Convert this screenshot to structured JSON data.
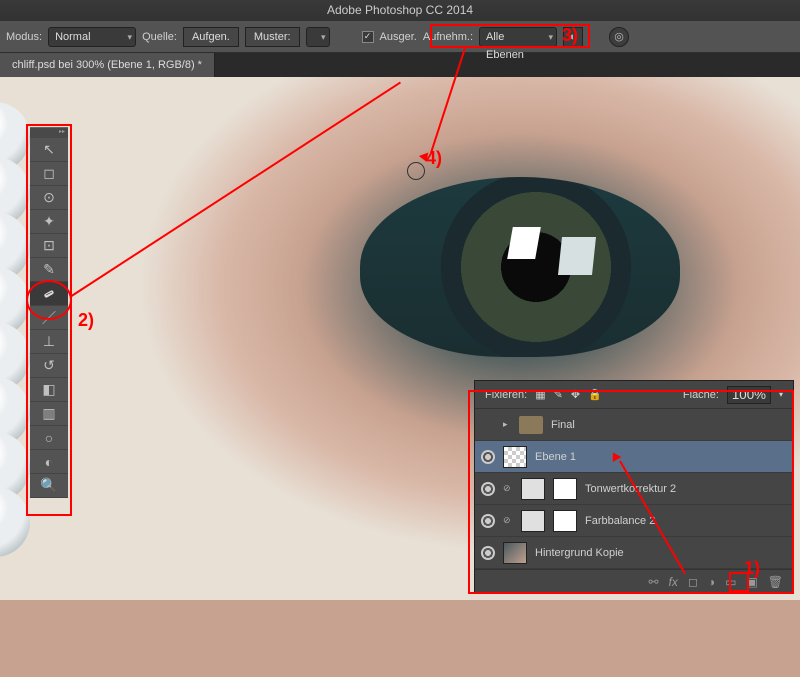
{
  "app": {
    "title": "Adobe Photoshop CC 2014"
  },
  "optbar": {
    "mode_label": "Modus:",
    "mode_value": "Normal",
    "source_label": "Quelle:",
    "source_btn1": "Aufgen.",
    "source_btn2": "Muster:",
    "aligned_label": "Ausger.",
    "sample_label": "Aufnehm.:",
    "sample_value": "Alle Ebenen"
  },
  "doc": {
    "tab": "chliff.psd bei 300% (Ebene 1, RGB/8) *"
  },
  "tools": {
    "move": "↖",
    "marquee": "◻",
    "lasso": "⊙",
    "magic": "✦",
    "crop": "⊡",
    "eyedrop": "✎",
    "heal": "✚",
    "brush": "／",
    "stamp": "⊥",
    "history": "↺",
    "eraser": "◧",
    "gradient": "▥",
    "blur": "○",
    "dodge": "◐",
    "pen": "✒",
    "zoom": "🔍"
  },
  "layers": {
    "lock_label": "Fixieren:",
    "fill_label": "Fläche:",
    "fill_value": "100%",
    "rows": {
      "final": "Final",
      "ebene1": "Ebene 1",
      "tone": "Tonwertkorrektur 2",
      "color": "Farbbalance 2",
      "bg": "Hintergrund Kopie"
    },
    "foot": {
      "fx": "fx",
      "mask": "◻",
      "adj": "◑",
      "grp": "▭",
      "new": "▣",
      "del": "🗑"
    }
  },
  "ann": {
    "a1": "1)",
    "a2": "2)",
    "a3": "3)",
    "a4": "4)"
  }
}
